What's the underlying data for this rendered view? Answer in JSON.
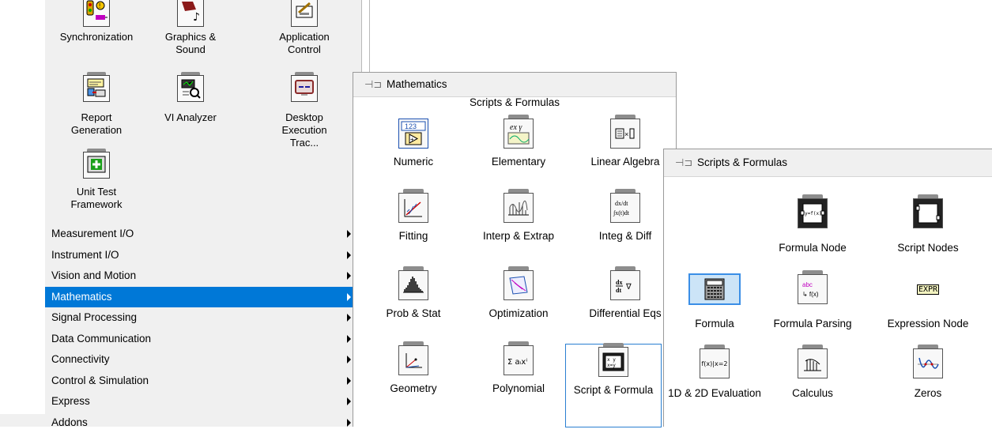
{
  "left_palette": {
    "icons": [
      {
        "label": "Synchronization",
        "icon": "synchronization-icon"
      },
      {
        "label": "Graphics & Sound",
        "icon": "graphics-sound-icon"
      },
      {
        "label": "Application Control",
        "icon": "application-control-icon"
      },
      {
        "label": "Report Generation",
        "icon": "report-generation-icon"
      },
      {
        "label": "VI Analyzer",
        "icon": "vi-analyzer-icon"
      },
      {
        "label": "Desktop Execution Trac...",
        "icon": "desktop-execution-trace-icon"
      },
      {
        "label": "Unit Test Framework",
        "icon": "unit-test-framework-icon"
      }
    ],
    "categories": [
      {
        "label": "Measurement I/O"
      },
      {
        "label": "Instrument I/O"
      },
      {
        "label": "Vision and Motion"
      },
      {
        "label": "Mathematics",
        "selected": true
      },
      {
        "label": "Signal Processing"
      },
      {
        "label": "Data Communication"
      },
      {
        "label": "Connectivity"
      },
      {
        "label": "Control & Simulation"
      },
      {
        "label": "Express"
      },
      {
        "label": "Addons"
      }
    ]
  },
  "math_popup": {
    "title": "Mathematics",
    "subtitle": "Scripts & Formulas",
    "items": [
      {
        "label": "Numeric",
        "icon": "numeric-icon"
      },
      {
        "label": "Elementary",
        "icon": "elementary-icon"
      },
      {
        "label": "Linear Algebra",
        "icon": "linear-algebra-icon"
      },
      {
        "label": "Fitting",
        "icon": "fitting-icon"
      },
      {
        "label": "Interp & Extrap",
        "icon": "interp-extrap-icon"
      },
      {
        "label": "Integ & Diff",
        "icon": "integ-diff-icon"
      },
      {
        "label": "Prob & Stat",
        "icon": "prob-stat-icon"
      },
      {
        "label": "Optimization",
        "icon": "optimization-icon"
      },
      {
        "label": "Differential Eqs",
        "icon": "differential-eqs-icon"
      },
      {
        "label": "Geometry",
        "icon": "geometry-icon"
      },
      {
        "label": "Polynomial",
        "icon": "polynomial-icon"
      },
      {
        "label": "Script & Formula",
        "icon": "script-formula-icon",
        "selected": true
      }
    ]
  },
  "scripts_popup": {
    "title": "Scripts & Formulas",
    "items": [
      {
        "label": "Formula Node",
        "icon": "formula-node-icon"
      },
      {
        "label": "Script Nodes",
        "icon": "script-nodes-icon"
      },
      {
        "label": "Formula",
        "icon": "formula-icon",
        "highlighted": true
      },
      {
        "label": "Formula Parsing",
        "icon": "formula-parsing-icon"
      },
      {
        "label": "Expression Node",
        "icon": "expression-node-icon"
      },
      {
        "label": "1D & 2D Evaluation",
        "icon": "evaluation-1d-2d-icon"
      },
      {
        "label": "Calculus",
        "icon": "calculus-icon"
      },
      {
        "label": "Zeros",
        "icon": "zeros-icon"
      }
    ]
  },
  "icon_glyphs": {
    "numeric": "123",
    "elementary": "ex γ",
    "integ_diff_top": "dx/dt",
    "integ_diff_bottom": "∫x(t)dt",
    "formula_parsing_top": "abc",
    "formula_parsing_bottom": "↳ f(x)",
    "expression_node": "EXPR",
    "evaluation": "f(x)|x=2",
    "polynomial": "Σ aᵢxⁱ"
  },
  "colors": {
    "selection_blue": "#0078d7",
    "palette_bg": "#f0f0f0",
    "cell_border": "#2a7fd1"
  }
}
